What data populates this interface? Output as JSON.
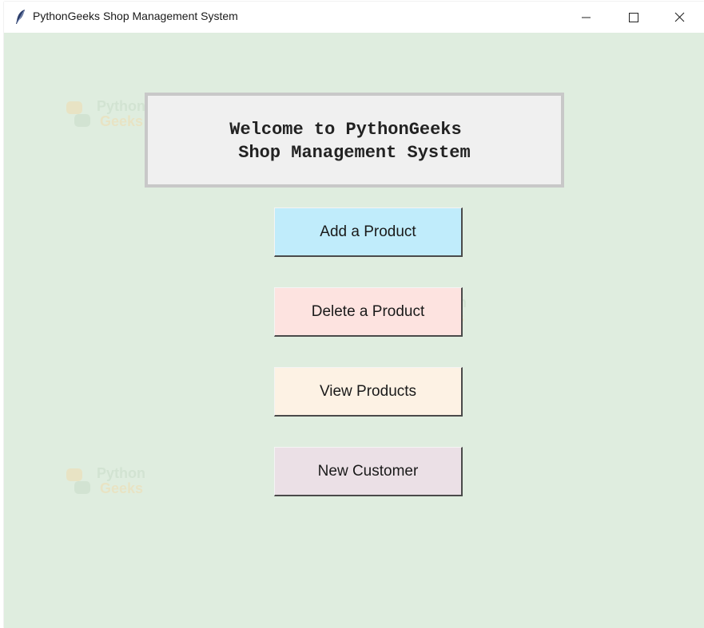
{
  "window": {
    "title": "PythonGeeks Shop Management System",
    "icon": "feather-icon",
    "controls": [
      "minimize-icon",
      "maximize-icon",
      "close-icon"
    ]
  },
  "welcome": {
    "line1": "Welcome to PythonGeeks",
    "line2": "Shop Management System"
  },
  "buttons": [
    {
      "label": "Add a Product",
      "color": "#c0ecfb"
    },
    {
      "label": "Delete a Product",
      "color": "#fde3e0"
    },
    {
      "label": "View Products",
      "color": "#fdf2e4"
    },
    {
      "label": "New Customer",
      "color": "#ebe0e6"
    }
  ],
  "watermark": {
    "top": "Python",
    "bottom": "Geeks"
  },
  "colors": {
    "background": "#dfeddf",
    "welcome_box": "#f0f0f0"
  }
}
